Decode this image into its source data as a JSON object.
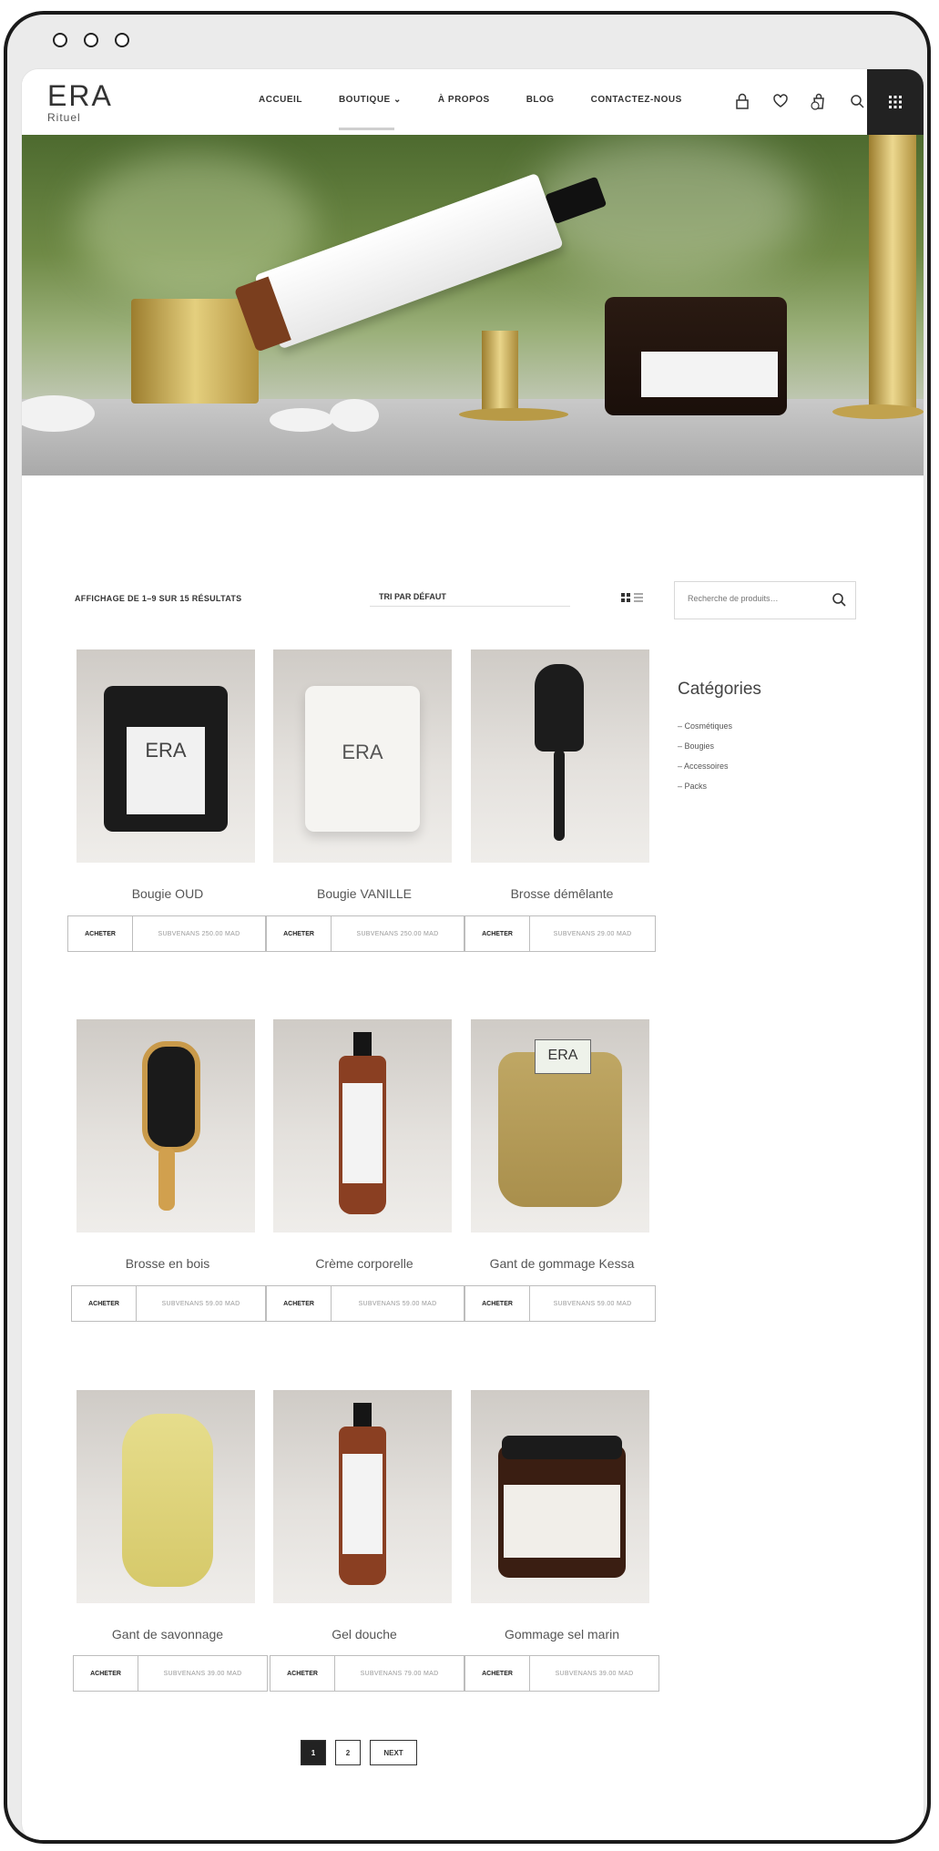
{
  "brand": {
    "name": "ERA",
    "tagline": "Rituel"
  },
  "nav": {
    "items": [
      "ACCUEIL",
      "BOUTIQUE",
      "À PROPOS",
      "BLOG",
      "CONTACTEZ-NOUS"
    ],
    "dropdown_glyph": "⌄"
  },
  "header_icons": [
    "lock-icon",
    "heart-icon",
    "cart-icon",
    "search-icon",
    "grid-menu-icon"
  ],
  "shop": {
    "results_text": "AFFICHAGE DE 1–9 SUR 15 RÉSULTATS",
    "sort_label": "TRI PAR DÉFAUT",
    "search_placeholder": "Recherche de produits…"
  },
  "sidebar": {
    "small_label": "",
    "title": "Catégories",
    "categories": [
      "Cosmétiques",
      "Bougies",
      "Accessoires",
      "Packs"
    ]
  },
  "products": [
    {
      "name": "Bougie OUD",
      "buy": "ACHETER",
      "price": "SUBVENANS 250.00 MAD"
    },
    {
      "name": "Bougie VANILLE",
      "buy": "ACHETER",
      "price": "SUBVENANS 250.00 MAD"
    },
    {
      "name": "Brosse démêlante",
      "buy": "ACHETER",
      "price": "SUBVENANS 29.00 MAD"
    },
    {
      "name": "Brosse en bois",
      "buy": "ACHETER",
      "price": "SUBVENANS 59.00 MAD"
    },
    {
      "name": "Crème corporelle",
      "buy": "ACHETER",
      "price": "SUBVENANS 59.00 MAD"
    },
    {
      "name": "Gant de gommage Kessa",
      "buy": "ACHETER",
      "price": "SUBVENANS 59.00 MAD"
    },
    {
      "name": "Gant de savonnage",
      "buy": "ACHETER",
      "price": "SUBVENANS 39.00 MAD"
    },
    {
      "name": "Gel douche",
      "buy": "ACHETER",
      "price": "SUBVENANS 79.00 MAD"
    },
    {
      "name": "Gommage sel marin",
      "buy": "ACHETER",
      "price": "SUBVENANS 39.00 MAD"
    }
  ],
  "pagination": {
    "pages": [
      "1",
      "2"
    ],
    "next": "NEXT",
    "current": "1"
  },
  "colors": {
    "dark": "#222222",
    "brass": "#c9a94e"
  }
}
